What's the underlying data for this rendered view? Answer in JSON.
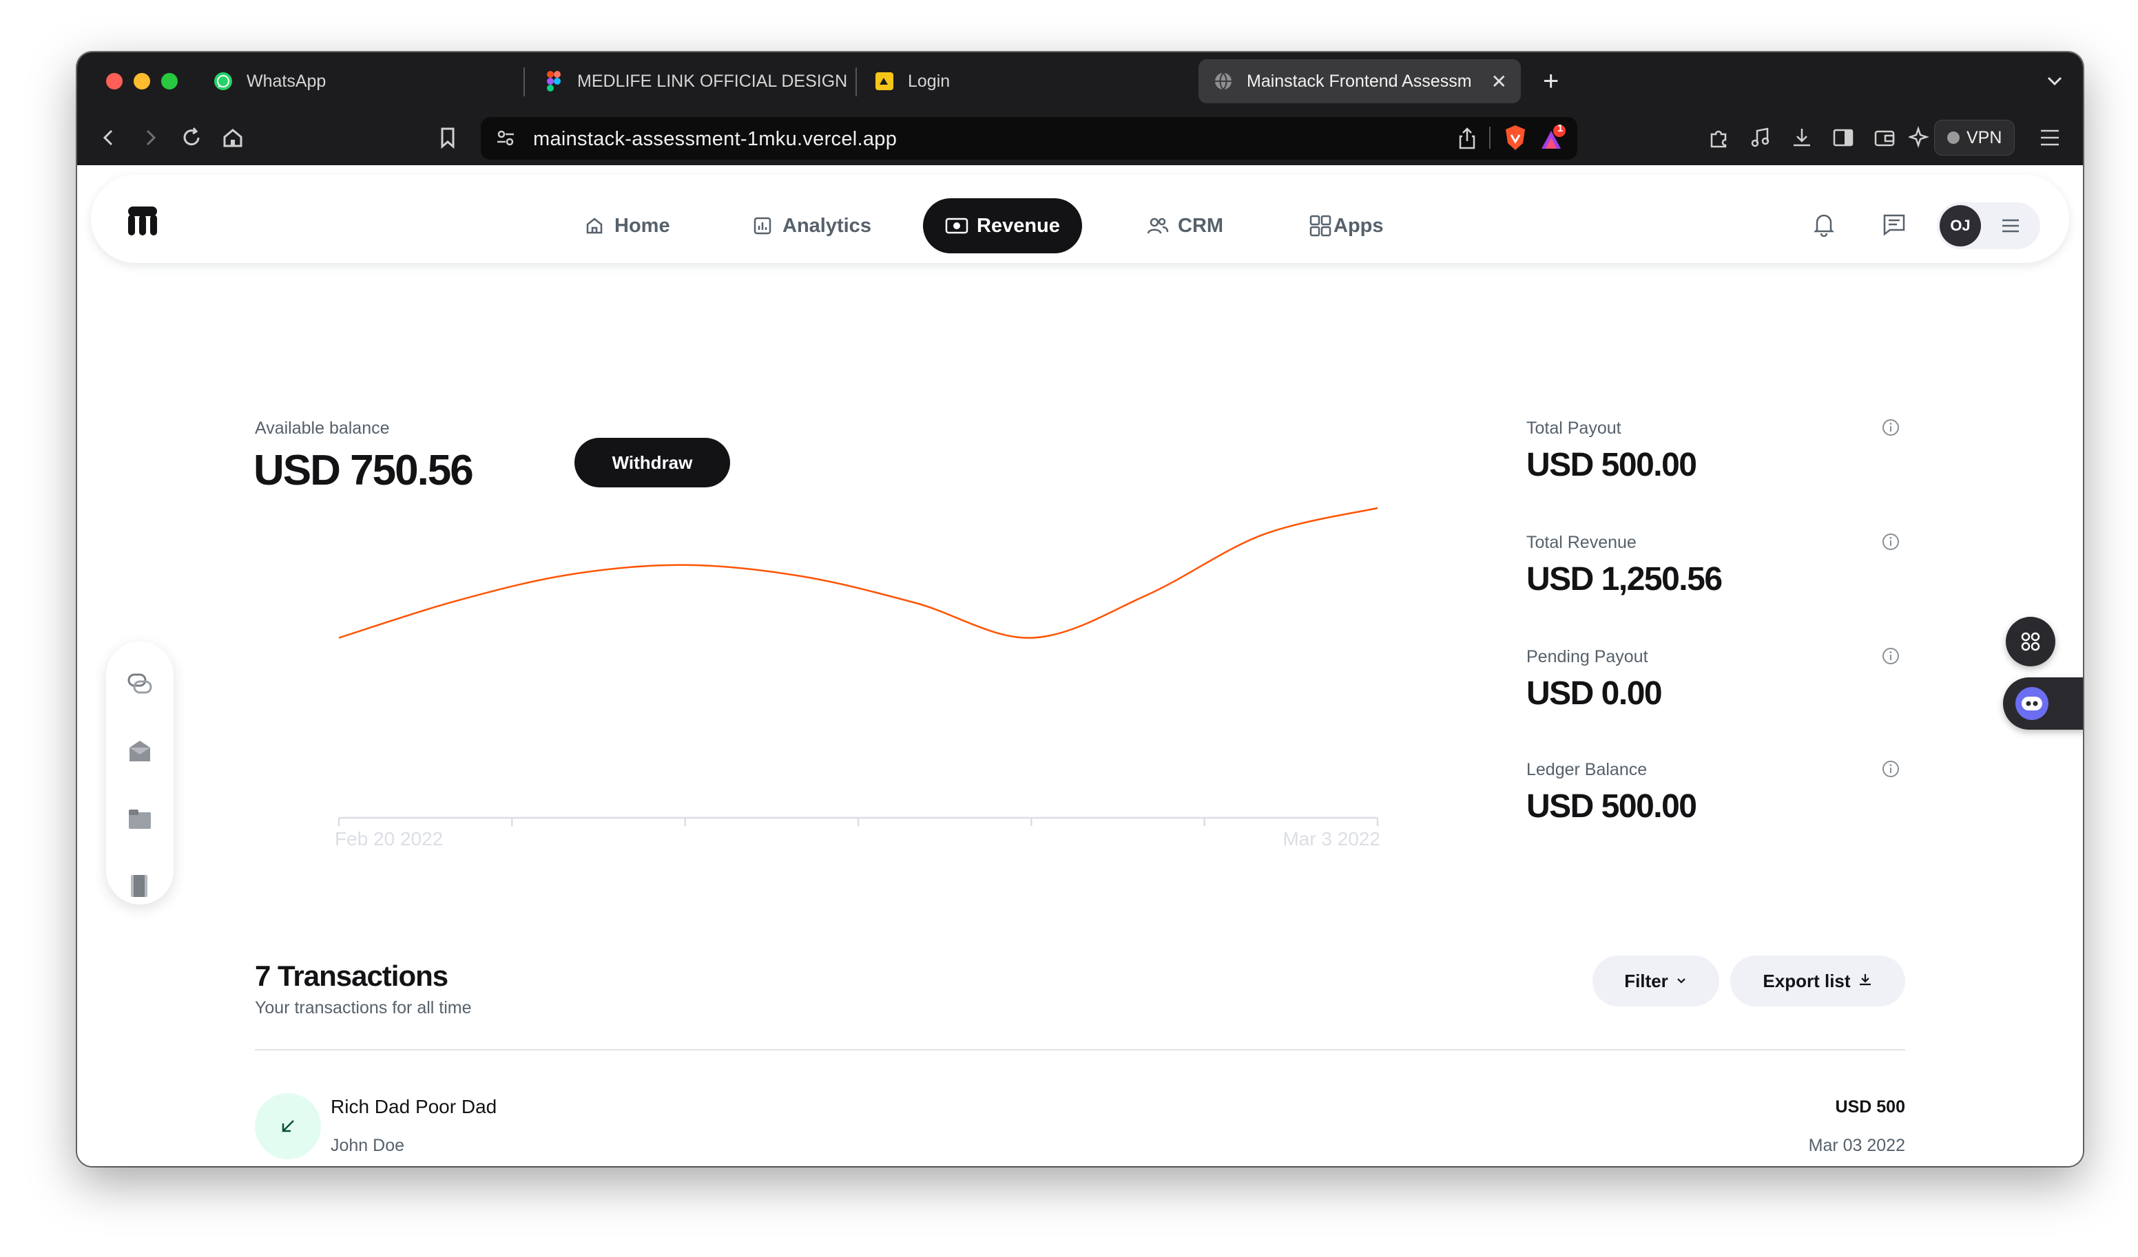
{
  "browser": {
    "tabs": [
      {
        "title": "WhatsApp"
      },
      {
        "title": "MEDLIFE LINK OFFICIAL DESIGN"
      },
      {
        "title": "Login"
      },
      {
        "title": "Mainstack Frontend Assessm"
      }
    ],
    "url": "mainstack-assessment-1mku.vercel.app",
    "vpn_label": "VPN",
    "notification_badge": "1"
  },
  "nav": {
    "items": [
      {
        "label": "Home"
      },
      {
        "label": "Analytics"
      },
      {
        "label": "Revenue"
      },
      {
        "label": "CRM"
      },
      {
        "label": "Apps"
      }
    ],
    "active": "Revenue",
    "user_initials": "OJ"
  },
  "balance": {
    "label": "Available balance",
    "value": "USD 750.56",
    "withdraw_label": "Withdraw"
  },
  "chart_data": {
    "type": "line",
    "x_start_label": "Feb 20 2022",
    "x_end_label": "Mar 3 2022",
    "line_color": "#ff5403",
    "series": [
      {
        "values": [
          0.18,
          0.41,
          0.58,
          0.64,
          0.57,
          0.4,
          0.18,
          0.45,
          0.83,
          1.0
        ]
      }
    ],
    "grid": false
  },
  "metrics": [
    {
      "label": "Total Payout",
      "value": "USD 500.00"
    },
    {
      "label": "Total Revenue",
      "value": "USD 1,250.56"
    },
    {
      "label": "Pending Payout",
      "value": "USD 0.00"
    },
    {
      "label": "Ledger Balance",
      "value": "USD 500.00"
    }
  ],
  "transactions": {
    "title": "7 Transactions",
    "subtitle": "Your transactions for all time",
    "filter_label": "Filter",
    "export_label": "Export list",
    "rows": [
      {
        "name": "Rich Dad Poor Dad",
        "person": "John Doe",
        "amount": "USD 500",
        "date": "Mar 03 2022",
        "status_color": "#075132"
      }
    ]
  },
  "colors": {
    "primary": "#131316",
    "muted": "#56616b",
    "accent": "#ff5403",
    "inflow_bg": "#e3fcf2"
  }
}
